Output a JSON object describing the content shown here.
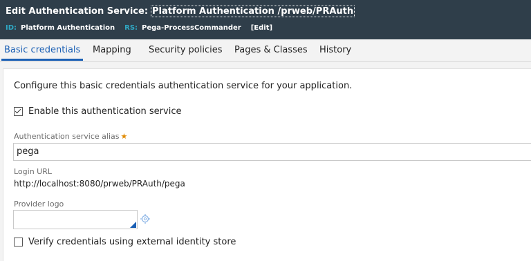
{
  "header": {
    "title_prefix": "Edit  Authentication Service:",
    "title_link": "Platform Authentication /prweb/PRAuth",
    "id_label": "ID:",
    "id_value": "Platform Authentication",
    "rs_label": "RS:",
    "rs_value": "Pega-ProcessCommander",
    "edit_label": "[Edit]"
  },
  "tabs": [
    {
      "label": "Basic credentials",
      "active": true
    },
    {
      "label": "Mapping",
      "active": false
    },
    {
      "label": "Security policies",
      "active": false
    },
    {
      "label": "Pages & Classes",
      "active": false
    },
    {
      "label": "History",
      "active": false
    }
  ],
  "form": {
    "intro": "Configure this basic credentials authentication service for your application.",
    "enable_label": "Enable this authentication service",
    "enable_checked": true,
    "alias_label": "Authentication service alias",
    "alias_required": "★",
    "alias_value": "pega",
    "login_url_label": "Login URL",
    "login_url_value": "http://localhost:8080/prweb/PRAuth/pega",
    "provider_logo_label": "Provider logo",
    "provider_logo_value": "",
    "verify_label": "Verify credentials using external identity store",
    "verify_checked": false
  },
  "colors": {
    "header_bg": "#2f3e4a",
    "accent": "#1a5fb4",
    "meta_label": "#2fa8c4",
    "required": "#e08a00"
  },
  "icons": {
    "picker": "target-icon"
  }
}
